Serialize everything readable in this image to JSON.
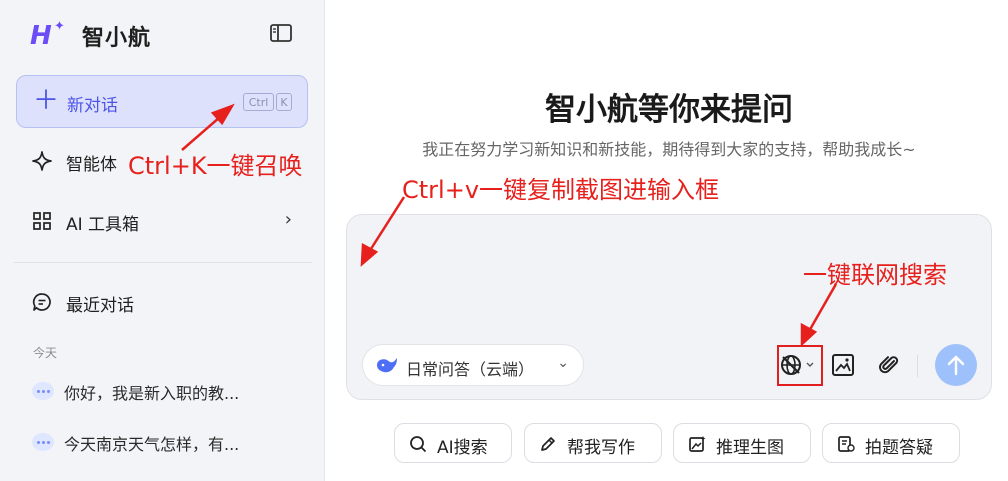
{
  "brand": {
    "logo_mark": "H",
    "name": "智小航"
  },
  "sidebar": {
    "new_chat": {
      "label": "新对话",
      "shortcut_keys": [
        "Ctrl",
        "K"
      ]
    },
    "items": [
      {
        "label": "智能体",
        "icon": "sparkle-icon"
      },
      {
        "label": "AI 工具箱",
        "icon": "grid-icon",
        "has_chevron": true
      },
      {
        "label": "最近对话",
        "icon": "chat-icon"
      }
    ],
    "section_today": "今天",
    "history": [
      {
        "text": "你好，我是新入职的教..."
      },
      {
        "text": "今天南京天气怎样，有..."
      }
    ]
  },
  "main": {
    "title": "智小航等你来提问",
    "subtitle": "我正在努力学习新知识和新技能，期待得到大家的支持，帮助我成长~",
    "composer": {
      "model": "日常问答（云端）",
      "tools": [
        "web-search-icon",
        "image-icon",
        "attachment-icon"
      ]
    },
    "chips": [
      {
        "label": "AI搜索",
        "icon": "search-icon"
      },
      {
        "label": "帮我写作",
        "icon": "pen-icon"
      },
      {
        "label": "推理生图",
        "icon": "image-gen-icon"
      },
      {
        "label": "拍题答疑",
        "icon": "question-doc-icon"
      }
    ]
  },
  "annotations": {
    "shortcut": "Ctrl+K一键召唤",
    "paste": "Ctrl+v一键复制截图进输入框",
    "web_search": "一键联网搜索"
  },
  "colors": {
    "accent": "#4c54e8",
    "annotation": "#e6201d",
    "send": "#9fc1fb",
    "brand": "#6b4cf6"
  }
}
